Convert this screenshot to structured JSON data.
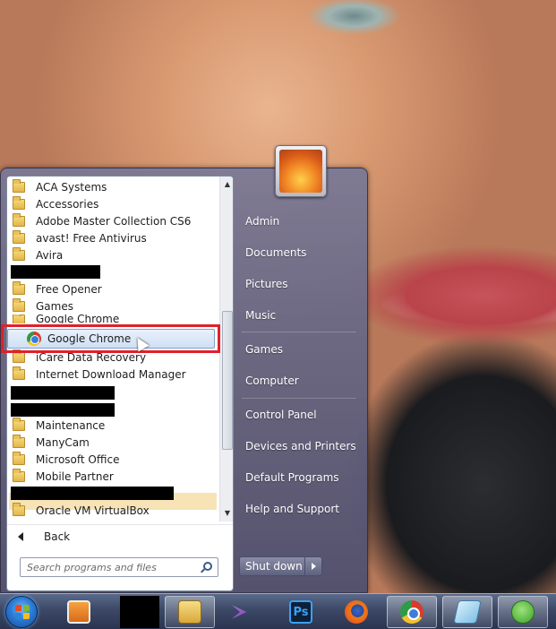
{
  "start_menu": {
    "programs": [
      {
        "label": "ACA Systems",
        "type": "folder"
      },
      {
        "label": "Accessories",
        "type": "folder"
      },
      {
        "label": "Adobe Master Collection CS6",
        "type": "folder"
      },
      {
        "label": "avast! Free Antivirus",
        "type": "folder"
      },
      {
        "label": "Avira",
        "type": "folder"
      },
      {
        "label": "",
        "type": "redacted"
      },
      {
        "label": "Free Opener",
        "type": "folder"
      },
      {
        "label": "Games",
        "type": "folder"
      },
      {
        "label": "Google Chrome",
        "type": "folder"
      },
      {
        "label": "Google Chrome",
        "type": "shortcut"
      },
      {
        "label": "iCare Data Recovery",
        "type": "folder"
      },
      {
        "label": "Internet Download Manager",
        "type": "folder"
      },
      {
        "label": "",
        "type": "redacted"
      },
      {
        "label": "",
        "type": "redacted"
      },
      {
        "label": "Maintenance",
        "type": "folder"
      },
      {
        "label": "ManyCam",
        "type": "folder"
      },
      {
        "label": "Microsoft Office",
        "type": "folder"
      },
      {
        "label": "Mobile Partner",
        "type": "folder"
      },
      {
        "label": "",
        "type": "redacted"
      },
      {
        "label": "Oracle VM VirtualBox",
        "type": "folder"
      }
    ],
    "back_label": "Back",
    "search_placeholder": "Search programs and files",
    "right_items": [
      "Admin",
      "Documents",
      "Pictures",
      "Music",
      "Games",
      "Computer",
      "Control Panel",
      "Devices and Printers",
      "Default Programs",
      "Help and Support"
    ],
    "shutdown_label": "Shut down"
  },
  "taskbar": {
    "apps": [
      "start-orb",
      "media-player-icon",
      "redacted-app",
      "windows-explorer-icon",
      "visual-studio-icon",
      "photoshop-icon",
      "firefox-icon",
      "chrome-icon",
      "notepad-icon",
      "green-app-icon"
    ],
    "photoshop_label": "Ps"
  },
  "colors": {
    "highlight_border": "#e0202a",
    "selected_item": "#cfe0f4",
    "menu_glass": "#5f5f7d"
  }
}
